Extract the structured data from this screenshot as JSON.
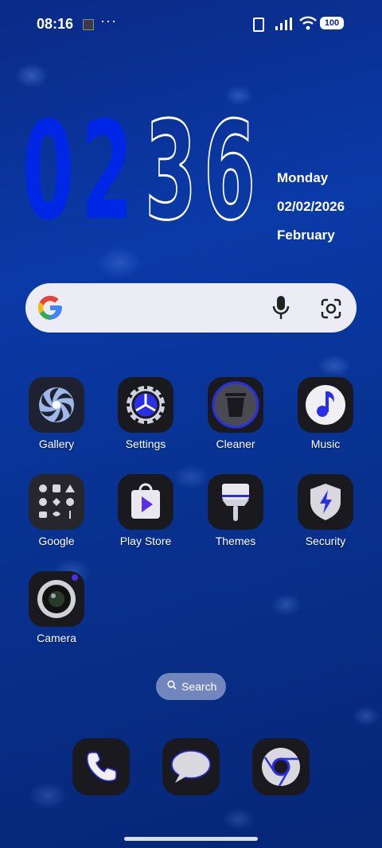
{
  "status": {
    "time": "08:16",
    "dots": "···",
    "battery": "100"
  },
  "clock": {
    "h1": "0",
    "h2": "2",
    "m1": "3",
    "m2": "6"
  },
  "date": {
    "day": "Monday",
    "date": "02/02/2026",
    "month": "February"
  },
  "apps": {
    "gallery": "Gallery",
    "settings": "Settings",
    "cleaner": "Cleaner",
    "music": "Music",
    "google": "Google",
    "playstore": "Play Store",
    "themes": "Themes",
    "security": "Security",
    "camera": "Camera"
  },
  "search_pill": {
    "label": "Search"
  },
  "colors": {
    "accent": "#2a2ee8",
    "clock_hour": "#0026e6"
  }
}
